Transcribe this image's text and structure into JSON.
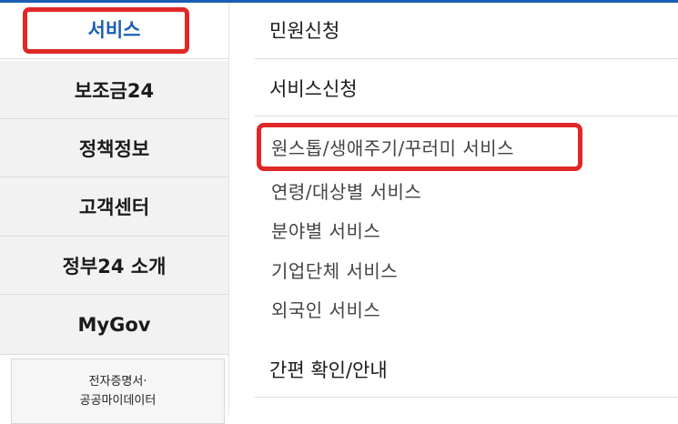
{
  "left_menu": {
    "items": [
      {
        "label": "서비스",
        "active": true
      },
      {
        "label": "보조금24",
        "active": false
      },
      {
        "label": "정책정보",
        "active": false
      },
      {
        "label": "고객센터",
        "active": false
      },
      {
        "label": "정부24 소개",
        "active": false
      },
      {
        "label": "MyGov",
        "active": false
      }
    ],
    "sub_box": {
      "line1": "전자증명서·",
      "line2": "공공마이데이터"
    }
  },
  "right_menu": {
    "headings": [
      "민원신청",
      "서비스신청",
      "간편 확인/안내"
    ],
    "service_items": [
      "원스톱/생애주기/꾸러미 서비스",
      "연령/대상별 서비스",
      "분야별 서비스",
      "기업단체 서비스",
      "외국인 서비스"
    ]
  },
  "colors": {
    "accent": "#1a5fb4",
    "highlight": "#e02828"
  }
}
